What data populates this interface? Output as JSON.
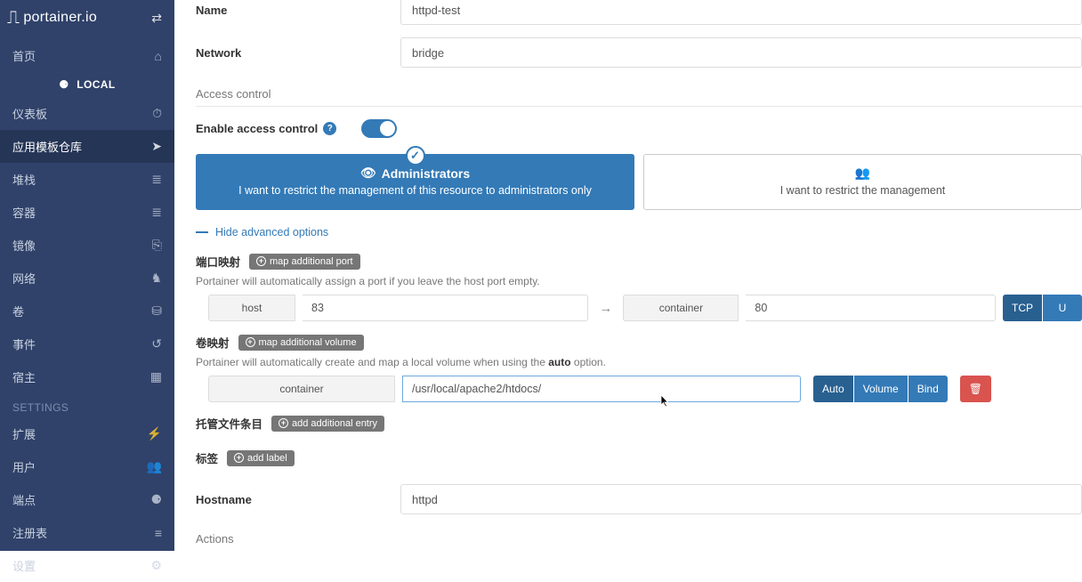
{
  "brand": "portainer.io",
  "env_label": "LOCAL",
  "sidebar": {
    "items": [
      {
        "label": "首页",
        "icon": "⌂"
      },
      {
        "label": "仪表板",
        "icon": "⏱"
      },
      {
        "label": "应用模板仓库",
        "icon": "➤"
      },
      {
        "label": "堆栈",
        "icon": "≣"
      },
      {
        "label": "容器",
        "icon": "≣"
      },
      {
        "label": "镜像",
        "icon": "⎘"
      },
      {
        "label": "网络",
        "icon": "♞"
      },
      {
        "label": "卷",
        "icon": "⛁"
      },
      {
        "label": "事件",
        "icon": "↺"
      },
      {
        "label": "宿主",
        "icon": "▦"
      }
    ],
    "settings_label": "SETTINGS",
    "settings": [
      {
        "label": "扩展",
        "icon": "⚡"
      },
      {
        "label": "用户",
        "icon": "👥"
      },
      {
        "label": "端点",
        "icon": "⚈"
      },
      {
        "label": "注册表",
        "icon": "≡"
      },
      {
        "label": "设置",
        "icon": "⚙"
      }
    ]
  },
  "form": {
    "name_label": "Name",
    "name_value": "httpd-test",
    "network_label": "Network",
    "network_value": "bridge",
    "access_header": "Access control",
    "enable_access_label": "Enable access control",
    "admin_title": "Administrators",
    "admin_desc": "I want to restrict the management of this resource to administrators only",
    "restricted_desc": "I want to restrict the management",
    "hide_adv": "Hide advanced options",
    "port_map": {
      "label": "端口映射",
      "pill": "map additional port",
      "hint": "Portainer will automatically assign a port if you leave the host port empty.",
      "host_addon": "host",
      "host_value": "83",
      "container_addon": "container",
      "container_value": "80",
      "tcp": "TCP",
      "udp": "U"
    },
    "vol_map": {
      "label": "卷映射",
      "pill": "map additional volume",
      "hint_prefix": "Portainer will automatically create and map a local volume when using the ",
      "hint_bold": "auto",
      "hint_suffix": " option.",
      "container_addon": "container",
      "container_value": "/usr/local/apache2/htdocs/",
      "auto": "Auto",
      "volume": "Volume",
      "bind": "Bind"
    },
    "hosts_file": {
      "label": "托管文件条目",
      "pill": "add additional entry"
    },
    "labels": {
      "label": "标签",
      "pill": "add label"
    },
    "hostname_label": "Hostname",
    "hostname_value": "httpd",
    "actions_label": "Actions"
  }
}
